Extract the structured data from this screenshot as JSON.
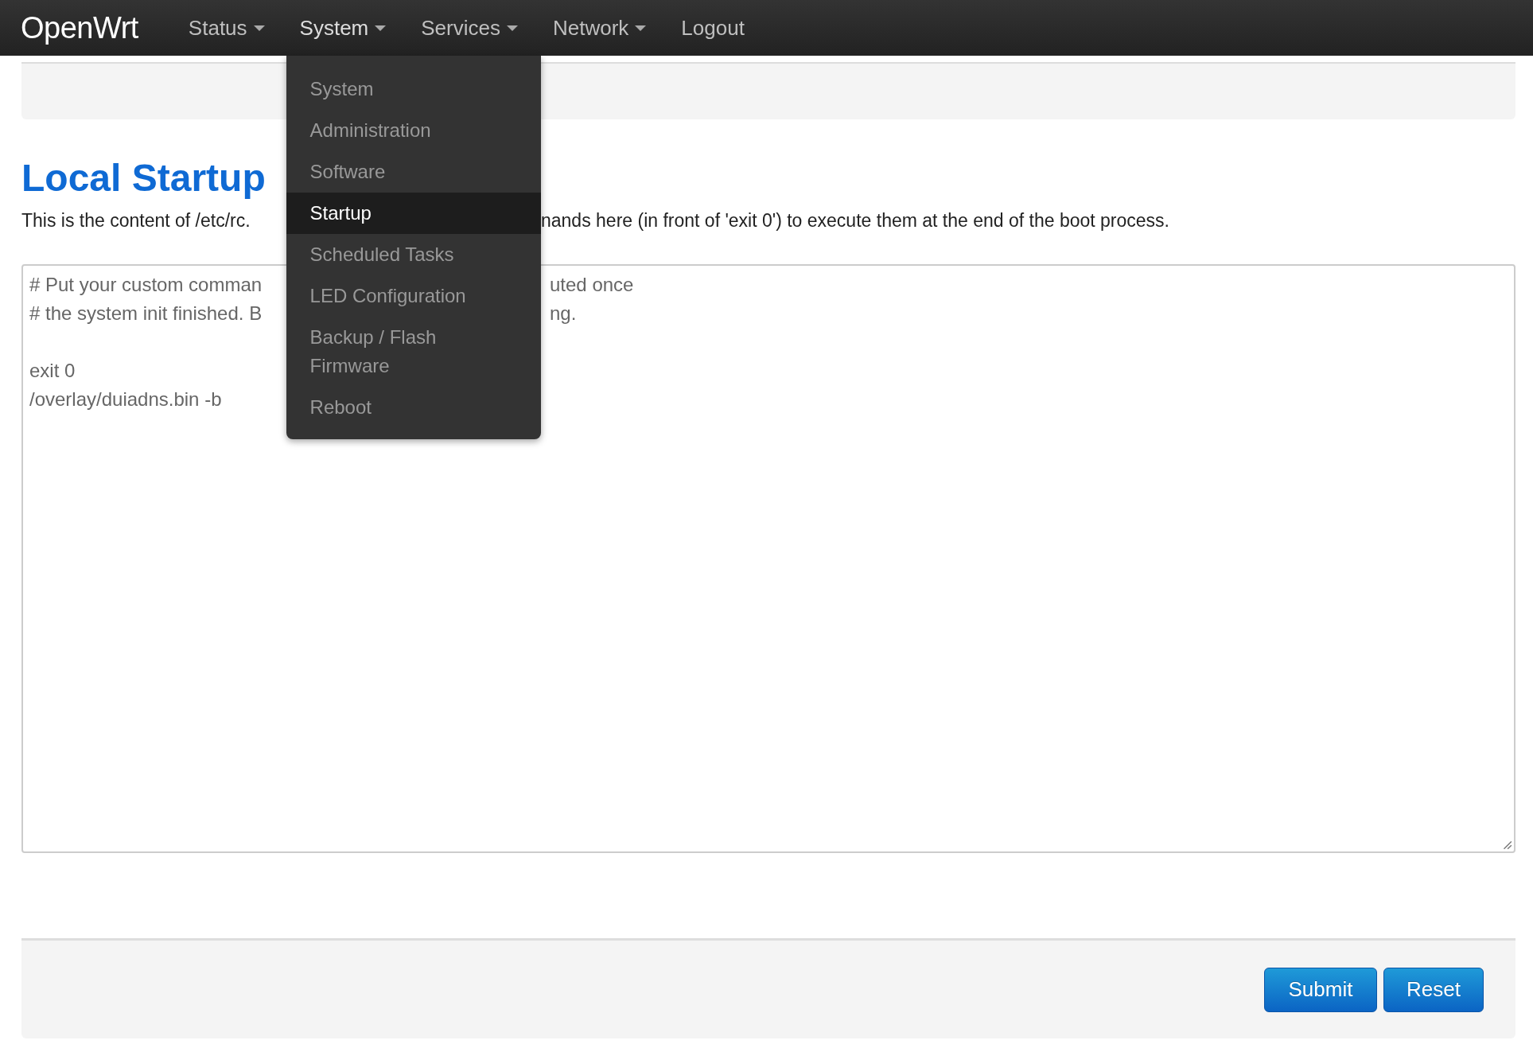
{
  "brand": "OpenWrt",
  "nav": [
    {
      "label": "Status",
      "dropdown": true,
      "expanded": false
    },
    {
      "label": "System",
      "dropdown": true,
      "expanded": true
    },
    {
      "label": "Services",
      "dropdown": true,
      "expanded": false
    },
    {
      "label": "Network",
      "dropdown": true,
      "expanded": false
    },
    {
      "label": "Logout",
      "dropdown": false,
      "expanded": false
    }
  ],
  "menu": [
    {
      "label": "System",
      "selected": false
    },
    {
      "label": "Administration",
      "selected": false
    },
    {
      "label": "Software",
      "selected": false
    },
    {
      "label": "Startup",
      "selected": true
    },
    {
      "label": "Scheduled Tasks",
      "selected": false
    },
    {
      "label": "LED Configuration",
      "selected": false
    },
    {
      "label": "Backup / Flash Firmware",
      "selected": false
    },
    {
      "label": "Reboot",
      "selected": false
    }
  ],
  "page": {
    "title": "Local Startup",
    "description": [
      "This is the content of /etc/rc.",
      "nands here (in front of 'exit 0') to execute them at the end of the boot process."
    ]
  },
  "editor": {
    "lines": [
      {
        "kind": "text",
        "parts": [
          "# Put your custom comman",
          "uted once"
        ]
      },
      {
        "kind": "text",
        "parts": [
          "# the system init finished. B",
          "ng."
        ]
      },
      {
        "kind": "blank"
      },
      {
        "kind": "text",
        "parts": [
          "exit 0"
        ]
      },
      {
        "kind": "text",
        "parts": [
          "/overlay/duiadns.bin -b"
        ]
      }
    ]
  },
  "buttons": [
    "Submit",
    "Reset"
  ]
}
